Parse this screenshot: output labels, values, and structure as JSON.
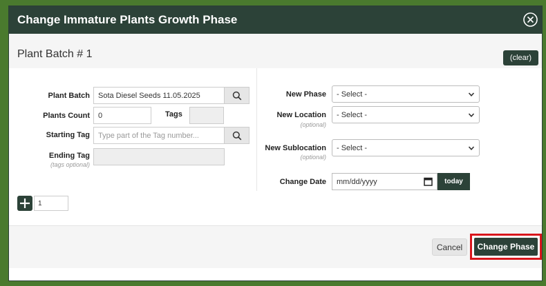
{
  "dialog": {
    "title": "Change Immature Plants Growth Phase",
    "close_icon": "close-circle-icon"
  },
  "batch": {
    "title": "Plant Batch # 1",
    "clear_label": "(clear)"
  },
  "left": {
    "plant_batch_label": "Plant Batch",
    "plant_batch_value": "Sota Diesel Seeds 11.05.2025",
    "plants_count_label": "Plants Count",
    "plants_count_value": "0",
    "tags_label": "Tags",
    "tags_value": "",
    "starting_tag_label": "Starting Tag",
    "starting_tag_placeholder": "Type part of the Tag number...",
    "ending_tag_label": "Ending Tag",
    "ending_tag_sub": "(tags optional)",
    "ending_tag_value": ""
  },
  "right": {
    "new_phase_label": "New Phase",
    "new_phase_value": "- Select -",
    "new_location_label": "New Location",
    "new_location_sub": "(optional)",
    "new_location_value": "- Select -",
    "new_sublocation_label": "New Sublocation",
    "new_sublocation_sub": "(optional)",
    "new_sublocation_value": "- Select -",
    "change_date_label": "Change Date",
    "change_date_placeholder": "mm/dd/yyyy",
    "today_label": "today"
  },
  "add_row": {
    "count_value": "1"
  },
  "footer": {
    "cancel_label": "Cancel",
    "change_phase_label": "Change Phase"
  },
  "colors": {
    "accent": "#2c4238",
    "outer_background": "#4a7a2e",
    "highlight": "#d9161c"
  }
}
